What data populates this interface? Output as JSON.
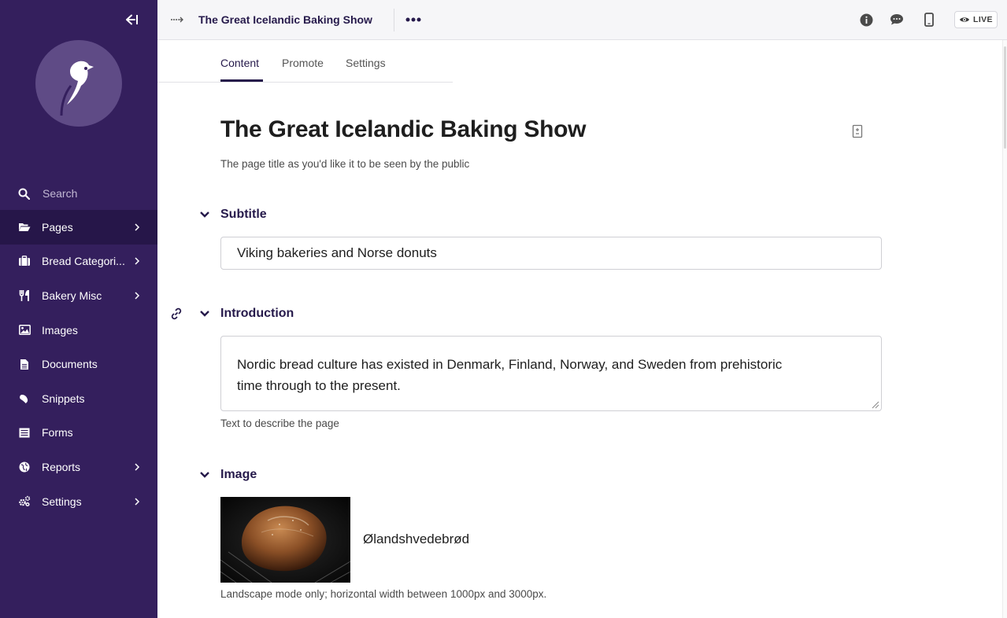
{
  "sidebar": {
    "search_label": "Search",
    "items": [
      {
        "label": "Pages",
        "icon": "folder-open-icon",
        "has_children": true,
        "active": true
      },
      {
        "label": "Bread Categori...",
        "icon": "suitcase-icon",
        "has_children": true
      },
      {
        "label": "Bakery Misc",
        "icon": "utensils-icon",
        "has_children": true
      },
      {
        "label": "Images",
        "icon": "image-icon",
        "has_children": false
      },
      {
        "label": "Documents",
        "icon": "doc-icon",
        "has_children": false
      },
      {
        "label": "Snippets",
        "icon": "snippet-icon",
        "has_children": false
      },
      {
        "label": "Forms",
        "icon": "form-icon",
        "has_children": false
      },
      {
        "label": "Reports",
        "icon": "globe-icon",
        "has_children": true
      },
      {
        "label": "Settings",
        "icon": "cogs-icon",
        "has_children": true
      }
    ]
  },
  "header": {
    "title": "The Great Icelandic Baking Show",
    "live_label": "LIVE"
  },
  "tabs": [
    "Content",
    "Promote",
    "Settings"
  ],
  "content": {
    "page_title": "The Great Icelandic Baking Show",
    "title_help": "The page title as you'd like it to be seen by the public",
    "subtitle": {
      "label": "Subtitle",
      "value": "Viking bakeries and Norse donuts"
    },
    "introduction": {
      "label": "Introduction",
      "value_line1": "Nordic bread culture has existed in Denmark, Finland, Norway, and Sweden from prehistoric",
      "value_line2": "time through to the present.",
      "help": "Text to describe the page"
    },
    "image": {
      "label": "Image",
      "name": "Ølandshvedebrød",
      "help": "Landscape mode only; horizontal width between 1000px and 3000px."
    }
  },
  "colors": {
    "sidebar_bg": "#341f5d",
    "sidebar_active": "#261649",
    "accent": "#261a4b"
  }
}
